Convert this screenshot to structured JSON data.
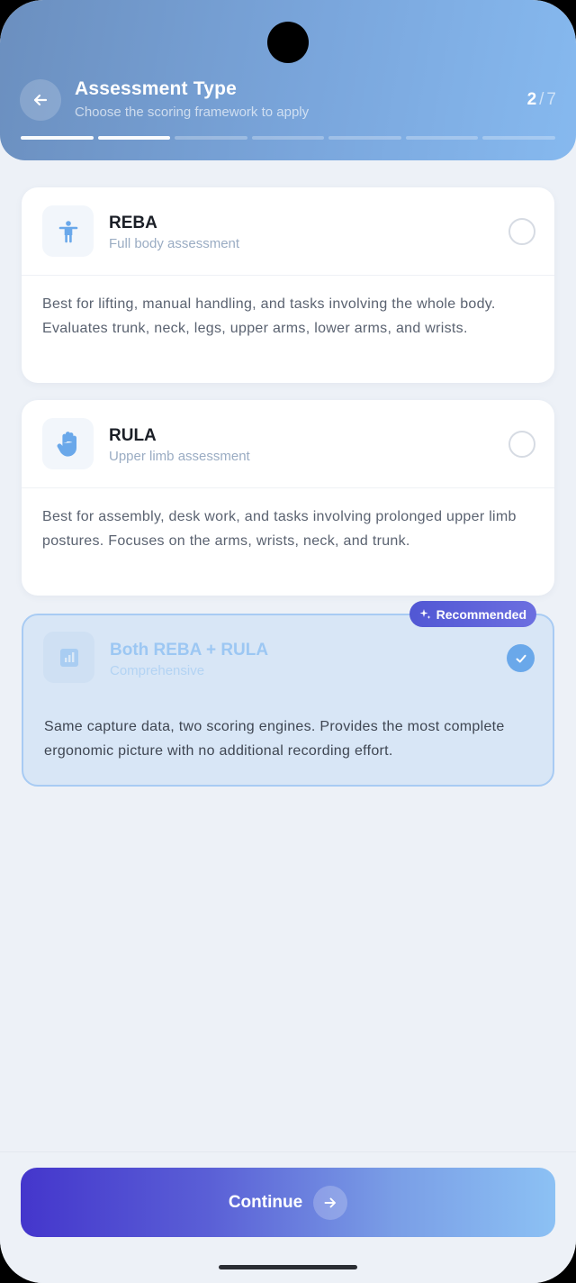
{
  "header": {
    "title": "Assessment Type",
    "subtitle": "Choose the scoring framework to apply",
    "step_current": "2",
    "step_separator": "/",
    "step_total": "7",
    "progress_segments": 7,
    "progress_completed": 2
  },
  "options": [
    {
      "name": "REBA",
      "subtitle": "Full body assessment",
      "icon": "person-standing-icon",
      "description": "Best for lifting, manual handling, and tasks involving the whole body. Evaluates trunk, neck, legs, upper arms, lower arms, and wrists.",
      "selected": false
    },
    {
      "name": "RULA",
      "subtitle": "Upper limb assessment",
      "icon": "hand-icon",
      "description": "Best for assembly, desk work, and tasks involving prolonged upper limb postures. Focuses on the arms, wrists, neck, and trunk.",
      "selected": false
    },
    {
      "name": "Both REBA + RULA",
      "subtitle": "Comprehensive",
      "icon": "bar-chart-icon",
      "description": "Same capture data, two scoring engines. Provides the most complete ergonomic picture with no additional recording effort.",
      "selected": true,
      "badge": "Recommended"
    }
  ],
  "footer": {
    "continue_label": "Continue"
  },
  "colors": {
    "accent": "#6aa8ea",
    "badge": "#5157d4",
    "button_start": "#4436cc",
    "button_end": "#8cc1f4"
  }
}
